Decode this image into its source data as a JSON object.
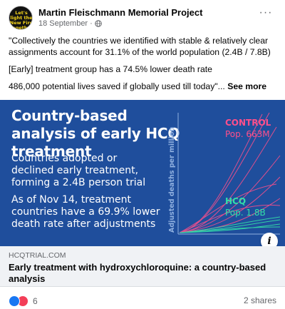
{
  "post": {
    "page_name": "Martin Fleischmann Memorial Project",
    "date": "18 September",
    "avatar_text": "Let's light the New Fire together",
    "lines": [
      "\"Collectively the countries we identified with stable & relatively clear assignments account for 31.1% of the world population (2.4B / 7.8B)",
      "[Early] treatment group has a 74.5% lower death rate",
      "486,000 potential lives saved if globally used till today\"..."
    ],
    "see_more": "See more"
  },
  "link_preview": {
    "headline": "Country-based analysis of early HCQ treatment",
    "para1": "Countries adopted or declined early treatment, forming a 2.4B person trial",
    "para2": "As of Nov 14, treatment countries have a 69.9% lower death rate after adjustments",
    "chart_ylabel": "Adjusted deaths per million",
    "control_label": "CONTROL",
    "control_pop": "Pop. 663M",
    "hcq_label": "HCQ",
    "hcq_pop": "Pop. 1.8B",
    "info_glyph": "i",
    "domain": "HCQTRIAL.COM",
    "title": "Early treatment with hydroxychloroquine: a country-based analysis"
  },
  "footer": {
    "reaction_count": "6",
    "shares": "2 shares"
  },
  "colors": {
    "image_bg": "#1f4e9c",
    "control": "#ff4f8b",
    "hcq": "#33e0a8"
  }
}
